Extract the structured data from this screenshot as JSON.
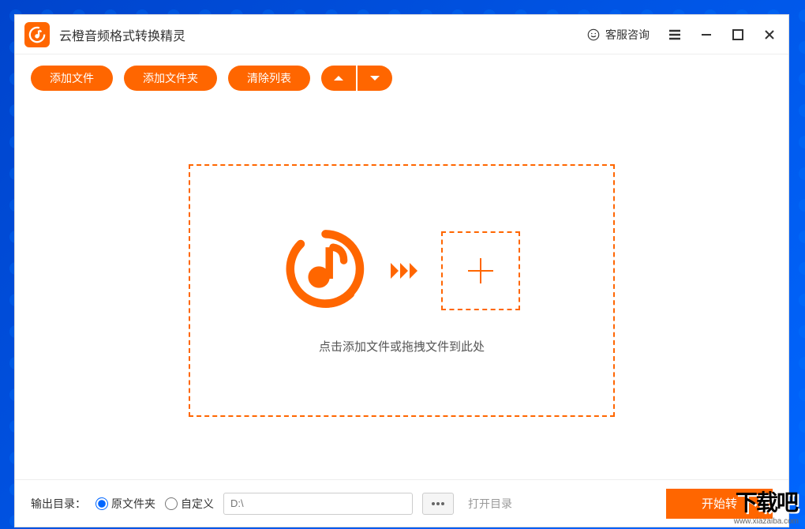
{
  "app": {
    "title": "云橙音频格式转换精灵",
    "support_label": "客服咨询"
  },
  "toolbar": {
    "add_file": "添加文件",
    "add_folder": "添加文件夹",
    "clear_list": "清除列表"
  },
  "dropzone": {
    "hint": "点击添加文件或拖拽文件到此处"
  },
  "output": {
    "label": "输出目录：",
    "radio_original": "原文件夹",
    "radio_custom": "自定义",
    "path_placeholder": "D:\\",
    "open_dir": "打开目录",
    "start_button": "开始转"
  },
  "watermark": {
    "text": "下载吧",
    "url": "www.xiazaiba.com"
  }
}
